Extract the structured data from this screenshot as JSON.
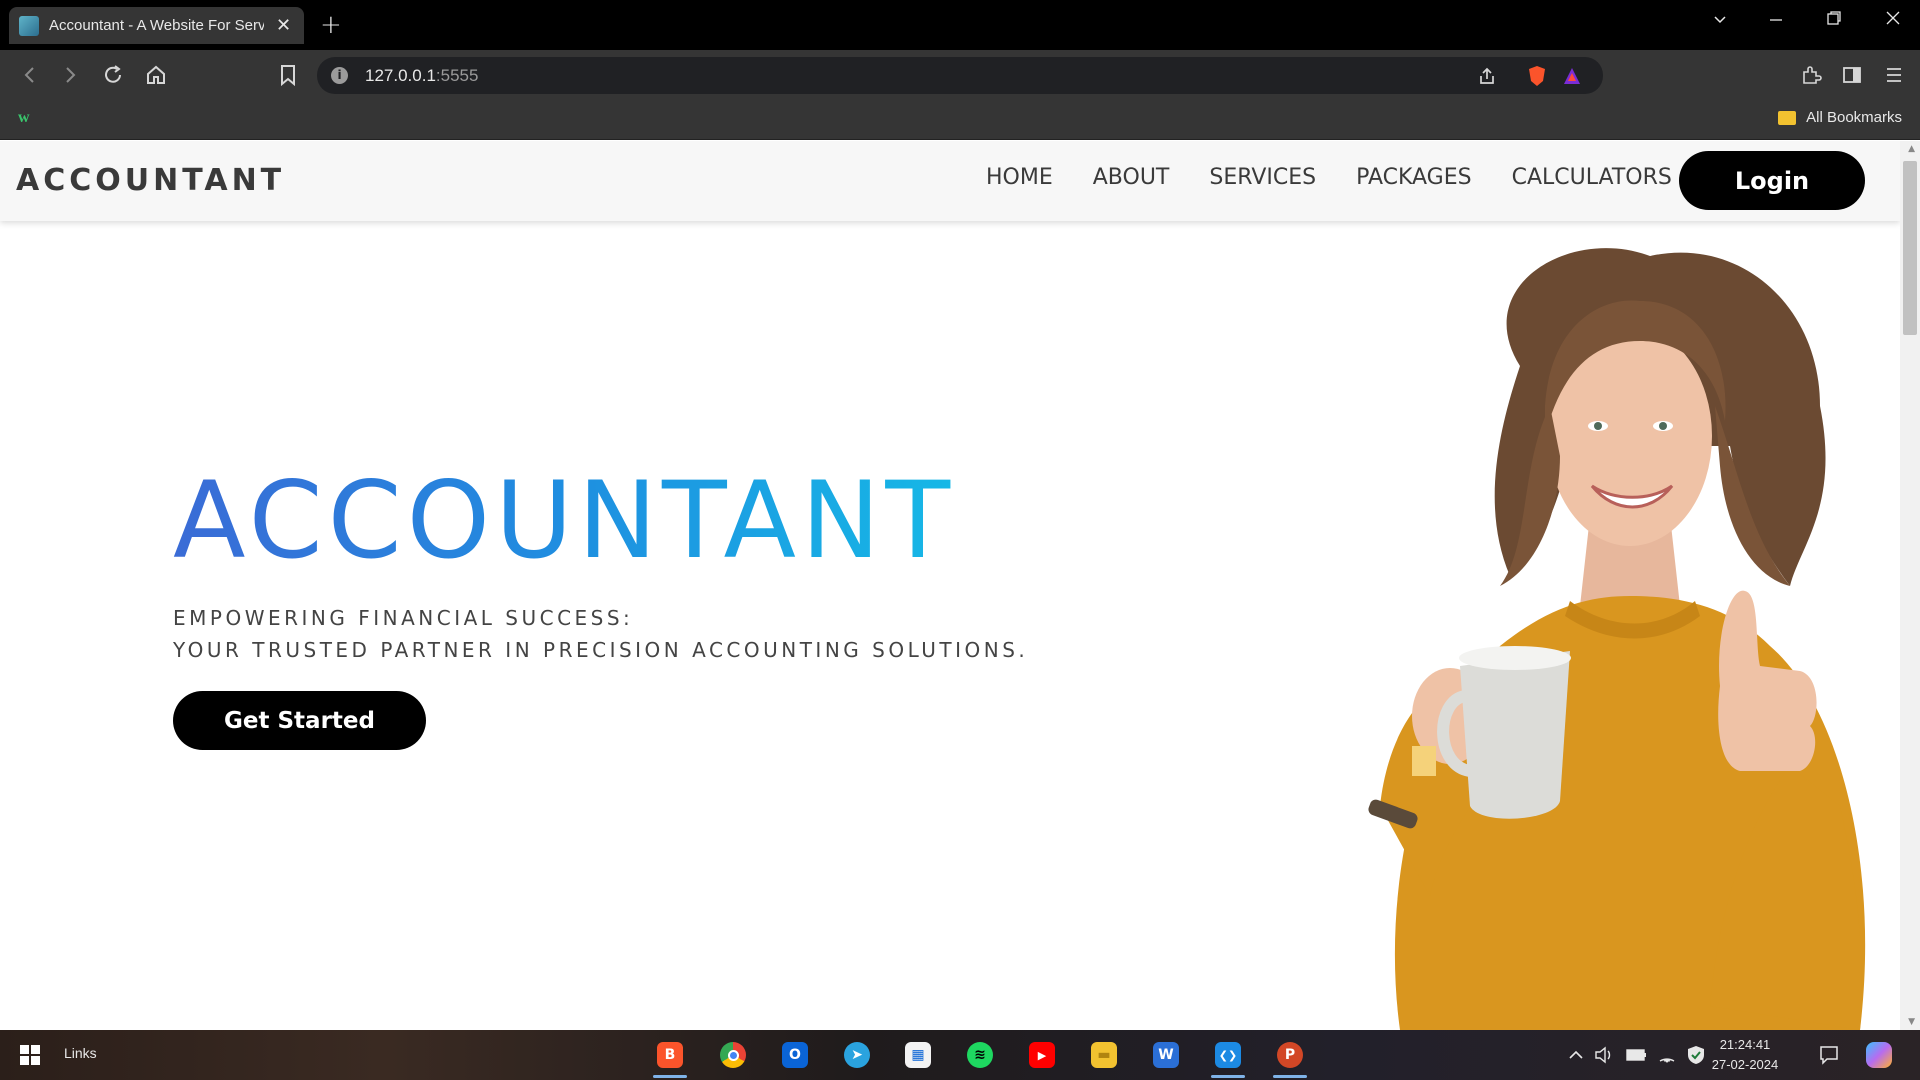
{
  "browser": {
    "tab_title": "Accountant - A Website For Serv",
    "tab_close": "✕",
    "new_tab": "+",
    "url_host": "127.0.0.1",
    "url_port": ":5555",
    "bookmarks_label": "All Bookmarks",
    "bookmark_w": "w"
  },
  "site": {
    "logo": "ACCOUNTANT",
    "nav": [
      "HOME",
      "ABOUT",
      "SERVICES",
      "PACKAGES",
      "CALCULATORS"
    ],
    "login_label": "Login",
    "hero_title": "ACCOUNTANT",
    "hero_sub_line1": "EMPOWERING FINANCIAL SUCCESS:",
    "hero_sub_line2": "YOUR TRUSTED PARTNER IN PRECISION ACCOUNTING SOLUTIONS.",
    "cta_label": "Get Started"
  },
  "taskbar": {
    "links_label": "Links",
    "time": "21:24:41",
    "date": "27-02-2024",
    "apps": [
      {
        "name": "brave",
        "glyph": "B",
        "color": "#fb542b"
      },
      {
        "name": "chrome",
        "glyph": "",
        "color": "#4285f4"
      },
      {
        "name": "outlook",
        "glyph": "O",
        "color": "#0a64d6"
      },
      {
        "name": "telegram",
        "glyph": "➤",
        "color": "#2aa3df"
      },
      {
        "name": "store",
        "glyph": "▦",
        "color": "#f3f3f3"
      },
      {
        "name": "spotify",
        "glyph": "≋",
        "color": "#1ed760"
      },
      {
        "name": "youtube",
        "glyph": "▶",
        "color": "#ff0000"
      },
      {
        "name": "explorer",
        "glyph": "▬",
        "color": "#f2c230"
      },
      {
        "name": "word",
        "glyph": "W",
        "color": "#2b6fd6"
      },
      {
        "name": "vscode",
        "glyph": "❮❯",
        "color": "#1c8ae3"
      },
      {
        "name": "powerpoint",
        "glyph": "P",
        "color": "#d24726"
      }
    ]
  },
  "colors": {
    "hero_gradient_start": "#3a6bd6",
    "hero_gradient_end": "#16b8e6",
    "button_bg": "#000000"
  }
}
